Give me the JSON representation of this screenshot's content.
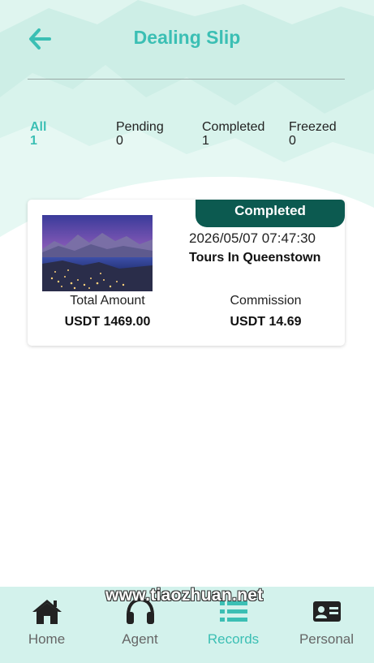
{
  "header": {
    "title": "Dealing Slip",
    "back_icon": "arrow-left-icon"
  },
  "tabs": [
    {
      "label": "All",
      "count": "1",
      "active": true
    },
    {
      "label": "Pending",
      "count": "0",
      "active": false
    },
    {
      "label": "Completed",
      "count": "1",
      "active": false
    },
    {
      "label": "Freezed",
      "count": "0",
      "active": false
    }
  ],
  "orders": [
    {
      "status": "Completed",
      "time": "2026/05/07 07:47:30",
      "product": "Tours In Queenstown",
      "total_label": "Total Amount",
      "total_value": "USDT 1469.00",
      "commission_label": "Commission",
      "commission_value": "USDT 14.69"
    }
  ],
  "bottom_nav": [
    {
      "label": "Home",
      "icon": "home-icon",
      "active": false
    },
    {
      "label": "Agent",
      "icon": "headset-icon",
      "active": false
    },
    {
      "label": "Records",
      "icon": "list-icon",
      "active": true
    },
    {
      "label": "Personal",
      "icon": "id-card-icon",
      "active": false
    }
  ],
  "watermark": "www.tiaozhuan.net",
  "colors": {
    "accent": "#3bbfb4",
    "badge": "#0c5a50",
    "nav_bg": "#d3f2ec"
  }
}
